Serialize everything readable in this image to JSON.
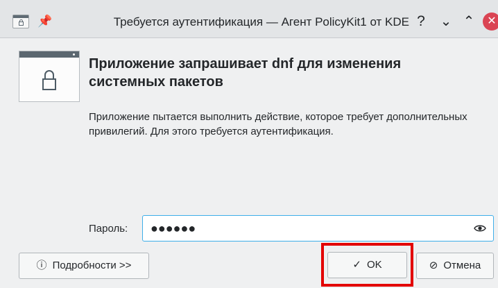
{
  "window": {
    "title": "Требуется аутентификация — Агент PolicyKit1 от KDE",
    "controls": {
      "help": "?",
      "minimize": "⌄",
      "maximize": "⌃",
      "close": "✕"
    },
    "icons": {
      "app": "lock-window-icon",
      "pin": "pin-icon"
    }
  },
  "content": {
    "icon": "lock-window-icon",
    "heading": "Приложение запрашивает dnf для изменения системных пакетов",
    "description": "Приложение пытается выполнить действие, которое требует дополнительных привилегий. Для этого требуется аутентификация."
  },
  "password": {
    "label": "Пароль:",
    "value": "●●●●●●",
    "reveal_icon": "eye-icon"
  },
  "buttons": {
    "details": {
      "icon": "ⓘ",
      "label": "Подробности >>"
    },
    "ok": {
      "icon": "✓",
      "label": "OK"
    },
    "cancel": {
      "icon": "⊘",
      "label": "Отмена"
    }
  },
  "colors": {
    "focus": "#3daee9",
    "close": "#da4453",
    "highlight": "#e30000"
  }
}
